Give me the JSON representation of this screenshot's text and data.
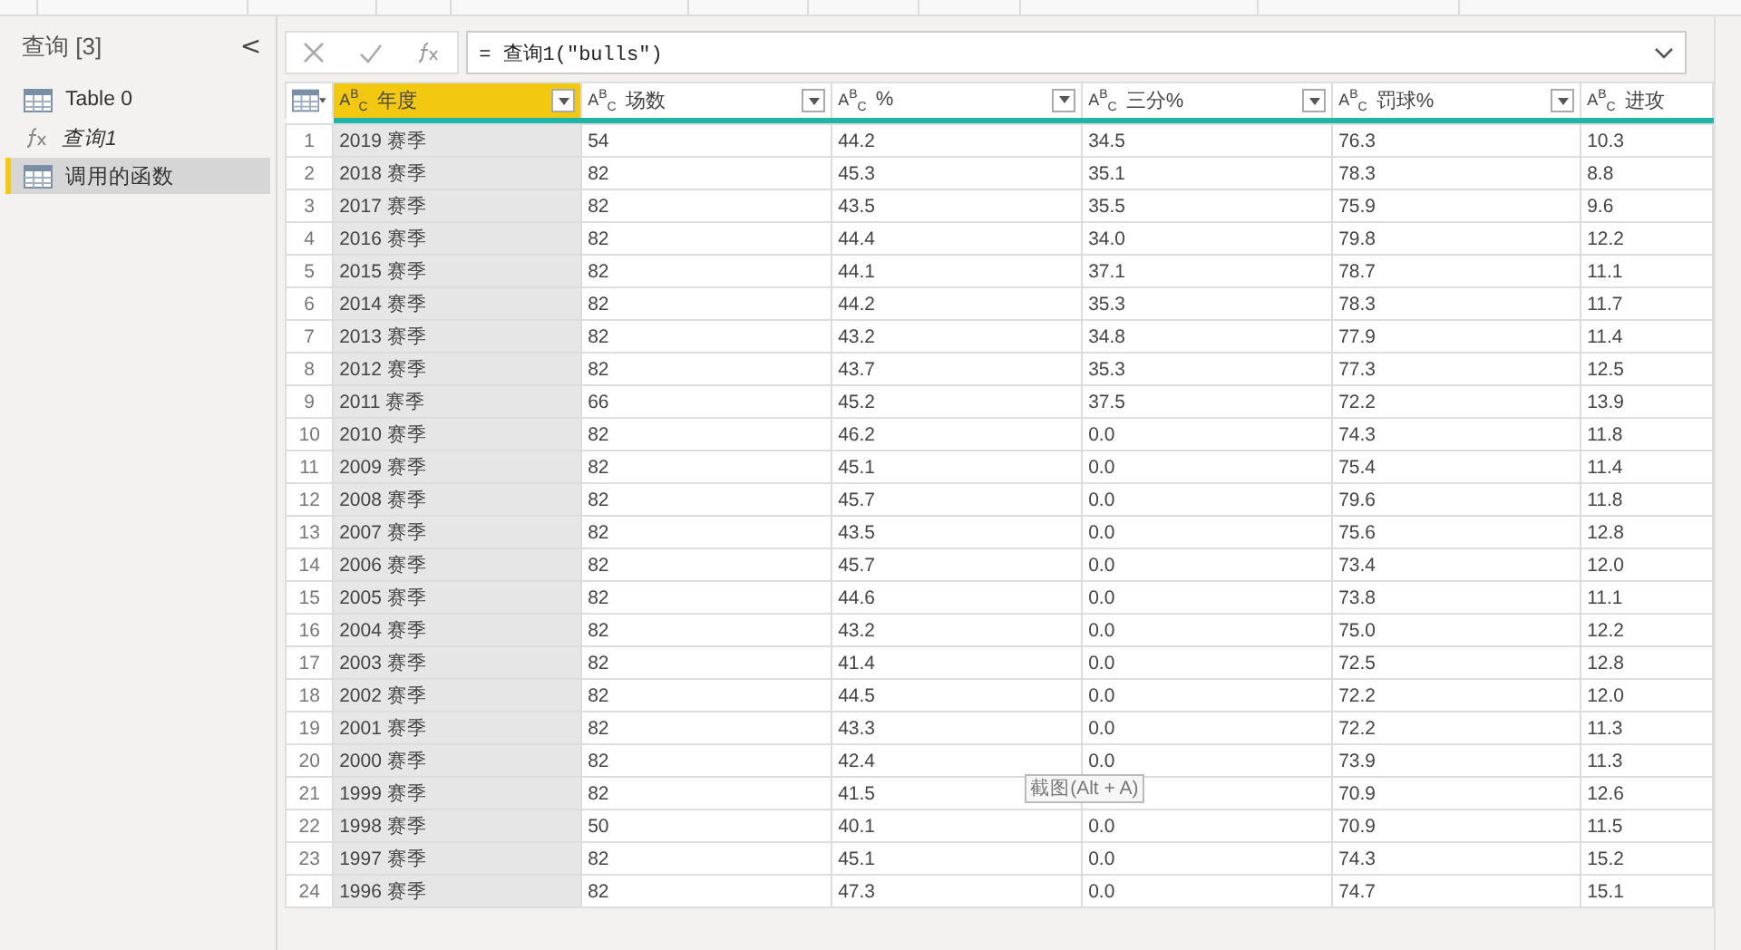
{
  "queries_panel": {
    "title": "查询 [3]",
    "collapse_glyph": "<",
    "items": [
      {
        "kind": "table",
        "label": "Table 0",
        "selected": false
      },
      {
        "kind": "function",
        "label": "查询1",
        "selected": false
      },
      {
        "kind": "table",
        "label": "调用的函数",
        "selected": true
      }
    ]
  },
  "formula_bar": {
    "formula": "= 查询1(\"bulls\")"
  },
  "table": {
    "columns": [
      {
        "type": "A$^{B}$$_{C}$",
        "name": "年度",
        "selected": true
      },
      {
        "type": "A$^{B}$$_{C}$",
        "name": "场数",
        "selected": false
      },
      {
        "type": "A$^{B}$$_{C}$",
        "name": "%",
        "selected": false
      },
      {
        "type": "A$^{B}$$_{C}$",
        "name": "三分%",
        "selected": false
      },
      {
        "type": "A$^{B}$$_{C}$",
        "name": "罚球%",
        "selected": false
      },
      {
        "type": "A$^{B}$$_{C}$",
        "name": "进攻",
        "selected": false
      }
    ],
    "rows": [
      {
        "number": "1",
        "cells": [
          "2019 赛季",
          "54",
          "44.2",
          "34.5",
          "76.3",
          "10.3"
        ]
      },
      {
        "number": "2",
        "cells": [
          "2018 赛季",
          "82",
          "45.3",
          "35.1",
          "78.3",
          "8.8"
        ]
      },
      {
        "number": "3",
        "cells": [
          "2017 赛季",
          "82",
          "43.5",
          "35.5",
          "75.9",
          "9.6"
        ]
      },
      {
        "number": "4",
        "cells": [
          "2016 赛季",
          "82",
          "44.4",
          "34.0",
          "79.8",
          "12.2"
        ]
      },
      {
        "number": "5",
        "cells": [
          "2015 赛季",
          "82",
          "44.1",
          "37.1",
          "78.7",
          "11.1"
        ]
      },
      {
        "number": "6",
        "cells": [
          "2014 赛季",
          "82",
          "44.2",
          "35.3",
          "78.3",
          "11.7"
        ]
      },
      {
        "number": "7",
        "cells": [
          "2013 赛季",
          "82",
          "43.2",
          "34.8",
          "77.9",
          "11.4"
        ]
      },
      {
        "number": "8",
        "cells": [
          "2012 赛季",
          "82",
          "43.7",
          "35.3",
          "77.3",
          "12.5"
        ]
      },
      {
        "number": "9",
        "cells": [
          "2011 赛季",
          "66",
          "45.2",
          "37.5",
          "72.2",
          "13.9"
        ]
      },
      {
        "number": "10",
        "cells": [
          "2010 赛季",
          "82",
          "46.2",
          "0.0",
          "74.3",
          "11.8"
        ]
      },
      {
        "number": "11",
        "cells": [
          "2009 赛季",
          "82",
          "45.1",
          "0.0",
          "75.4",
          "11.4"
        ]
      },
      {
        "number": "12",
        "cells": [
          "2008 赛季",
          "82",
          "45.7",
          "0.0",
          "79.6",
          "11.8"
        ]
      },
      {
        "number": "13",
        "cells": [
          "2007 赛季",
          "82",
          "43.5",
          "0.0",
          "75.6",
          "12.8"
        ]
      },
      {
        "number": "14",
        "cells": [
          "2006 赛季",
          "82",
          "45.7",
          "0.0",
          "73.4",
          "12.0"
        ]
      },
      {
        "number": "15",
        "cells": [
          "2005 赛季",
          "82",
          "44.6",
          "0.0",
          "73.8",
          "11.1"
        ]
      },
      {
        "number": "16",
        "cells": [
          "2004 赛季",
          "82",
          "43.2",
          "0.0",
          "75.0",
          "12.2"
        ]
      },
      {
        "number": "17",
        "cells": [
          "2003 赛季",
          "82",
          "41.4",
          "0.0",
          "72.5",
          "12.8"
        ]
      },
      {
        "number": "18",
        "cells": [
          "2002 赛季",
          "82",
          "44.5",
          "0.0",
          "72.2",
          "12.0"
        ]
      },
      {
        "number": "19",
        "cells": [
          "2001 赛季",
          "82",
          "43.3",
          "0.0",
          "72.2",
          "11.3"
        ]
      },
      {
        "number": "20",
        "cells": [
          "2000 赛季",
          "82",
          "42.4",
          "0.0",
          "73.9",
          "11.3"
        ]
      },
      {
        "number": "21",
        "cells": [
          "1999 赛季",
          "82",
          "41.5",
          null,
          "70.9",
          "12.6"
        ]
      },
      {
        "number": "22",
        "cells": [
          "1998 赛季",
          "50",
          "40.1",
          "0.0",
          "70.9",
          "11.5"
        ]
      },
      {
        "number": "23",
        "cells": [
          "1997 赛季",
          "82",
          "45.1",
          "0.0",
          "74.3",
          "15.2"
        ]
      },
      {
        "number": "24",
        "cells": [
          "1996 赛季",
          "82",
          "47.3",
          "0.0",
          "74.7",
          "15.1"
        ]
      }
    ]
  },
  "tooltip": {
    "text": "截图(Alt + A)"
  }
}
